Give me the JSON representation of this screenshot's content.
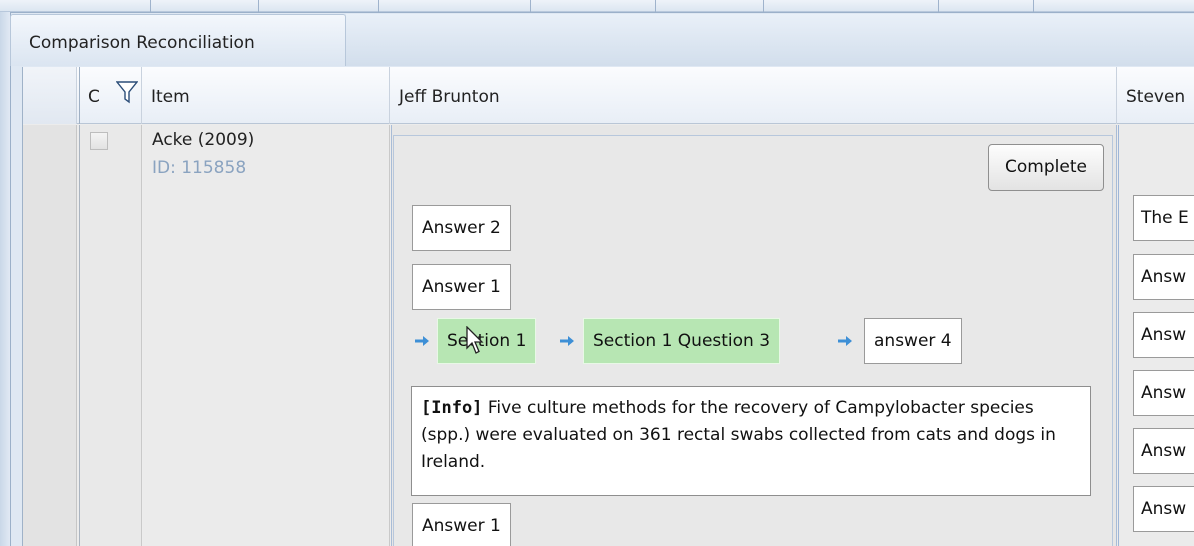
{
  "window": {
    "title": "Comparison Reconciliation"
  },
  "columns": {
    "completed_short": "C",
    "item": "Item",
    "reviewer_1": "Jeff Brunton",
    "reviewer_2": "Steven"
  },
  "row": {
    "item_title": "Acke (2009)",
    "item_id": "ID: 115858",
    "reviewer_1": {
      "complete_label": "Complete",
      "answers_top": [
        "Answer 2",
        "Answer 1"
      ],
      "path": [
        "Section 1",
        "Section 1 Question 3",
        "answer 4"
      ],
      "info_tag": "[Info]",
      "info_text": " Five culture methods for the recovery of Campylobacter species (spp.) were evaluated on 361 rectal swabs collected from cats and dogs in Ireland.",
      "answer_bottom": "Answer 1"
    },
    "reviewer_2": {
      "answers": [
        "The E",
        "Answ",
        "Answ",
        "Answ",
        "Answ",
        "Answ"
      ]
    }
  },
  "colors": {
    "chip_green": "#b7e6b3",
    "arrow_blue": "#3d8fd6",
    "id_blue": "#8aa3c0"
  }
}
